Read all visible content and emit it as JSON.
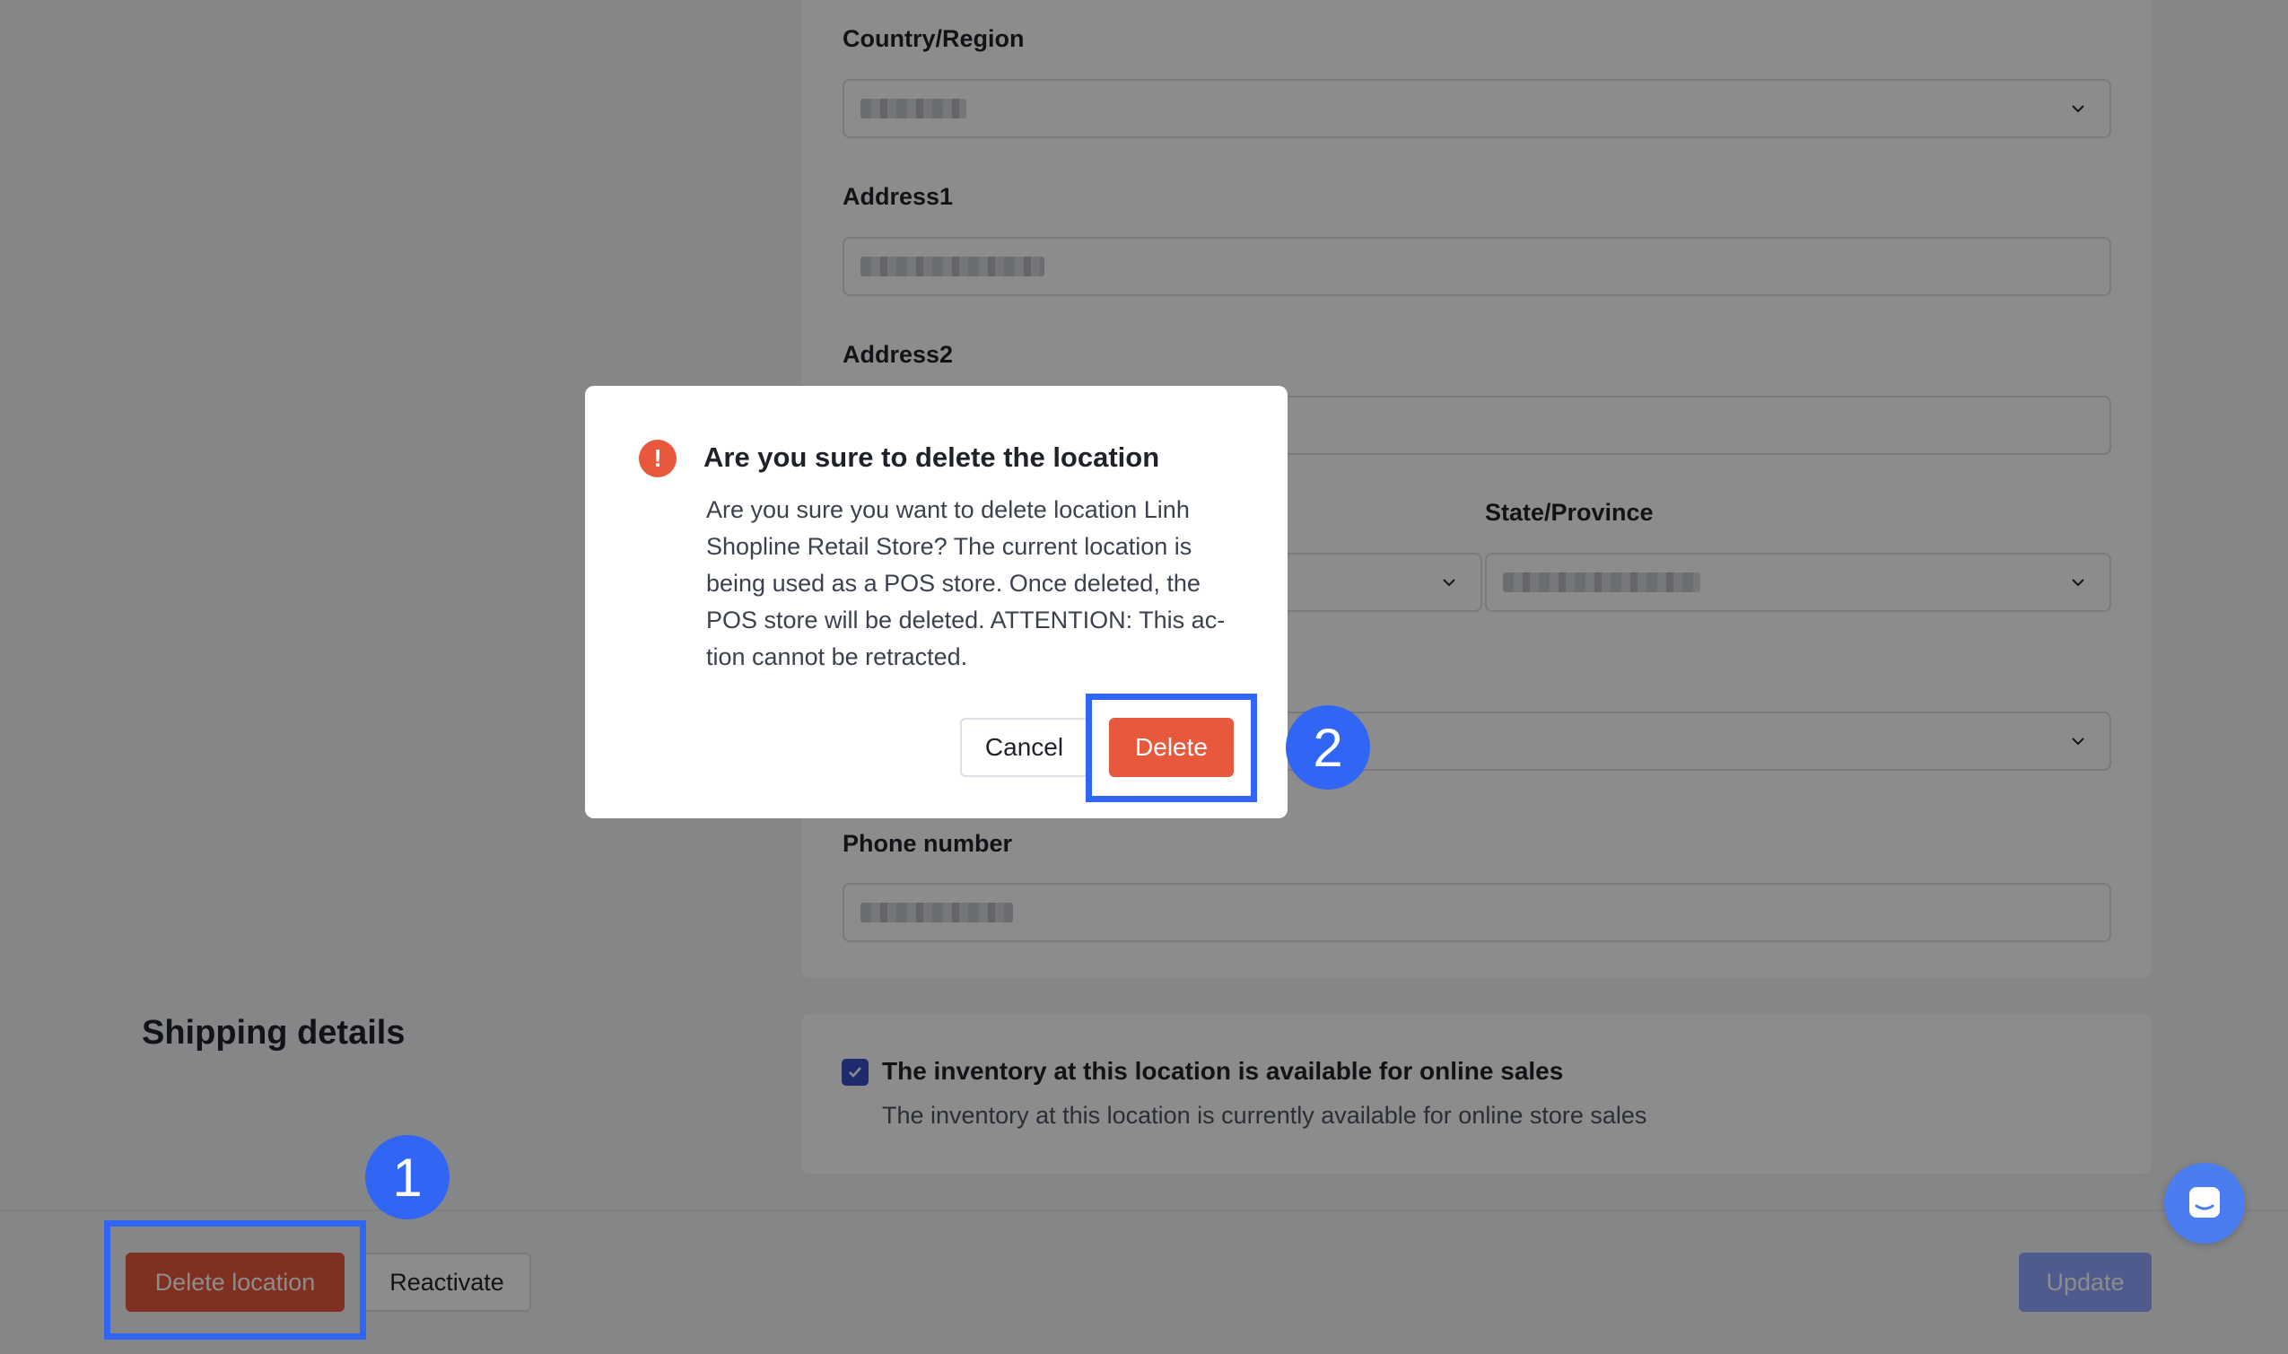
{
  "address_form": {
    "country_label": "Country/Region",
    "address1_label": "Address1",
    "address2_label": "Address2",
    "state_label": "State/Province",
    "phone_label": "Phone number"
  },
  "shipping": {
    "section_title": "Shipping details",
    "checkbox_checked": true,
    "checkbox_label": "The inventory at this location is available for online sales",
    "checkbox_desc": "The inventory at this location is currently available for online store sales"
  },
  "footer": {
    "delete_location_label": "Delete location",
    "reactivate_label": "Reactivate",
    "update_label": "Update"
  },
  "modal": {
    "title": "Are you sure to delete the location",
    "icon": "!",
    "body": "Are you sure you want to delete location Linh Shopline Retail Store? The current location is being used as a POS store. Once deleted, the POS store will be deleted. ATTENTION: This ac-tion cannot be retracted.",
    "cancel_label": "Cancel",
    "delete_label": "Delete"
  },
  "annotations": {
    "step1": "1",
    "step2": "2"
  },
  "colors": {
    "accent": "#3166f5",
    "danger": "#e8583c",
    "primary_disabled": "#8ea6ff",
    "checkbox": "#3b4fc9"
  }
}
